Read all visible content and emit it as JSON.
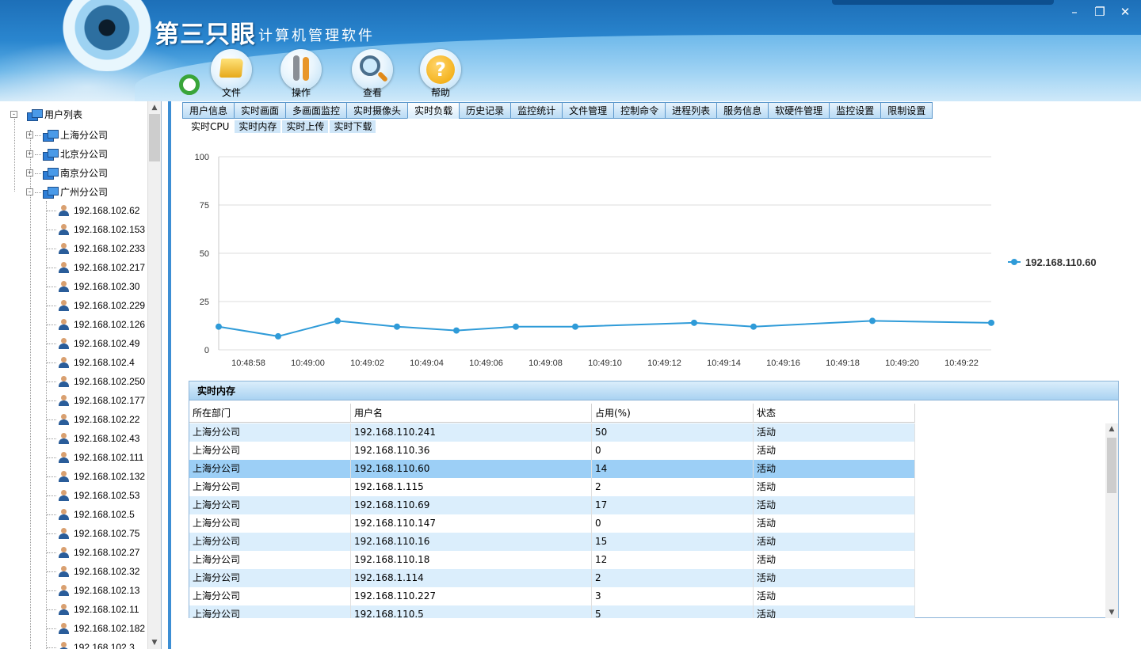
{
  "app": {
    "logo_text": "第三只眼",
    "subtitle": "计算机管理软件",
    "window_controls": {
      "minimize": "–",
      "restore": "❐",
      "close": "✕"
    }
  },
  "toolbar": {
    "items": [
      {
        "label": "文件",
        "icon": "folder-icon"
      },
      {
        "label": "操作",
        "icon": "tools-icon"
      },
      {
        "label": "查看",
        "icon": "magnifier-icon"
      },
      {
        "label": "帮助",
        "icon": "help-icon"
      }
    ],
    "help_glyph": "?"
  },
  "tree": {
    "root_label": "用户列表",
    "groups": [
      {
        "label": "上海分公司",
        "expander": "+"
      },
      {
        "label": "北京分公司",
        "expander": "+"
      },
      {
        "label": "南京分公司",
        "expander": "+"
      },
      {
        "label": "广州分公司",
        "expander": "-"
      }
    ],
    "root_expander": "-",
    "hosts": [
      "192.168.102.62",
      "192.168.102.153",
      "192.168.102.233",
      "192.168.102.217",
      "192.168.102.30",
      "192.168.102.229",
      "192.168.102.126",
      "192.168.102.49",
      "192.168.102.4",
      "192.168.102.250",
      "192.168.102.177",
      "192.168.102.22",
      "192.168.102.43",
      "192.168.102.111",
      "192.168.102.132",
      "192.168.102.53",
      "192.168.102.5",
      "192.168.102.75",
      "192.168.102.27",
      "192.168.102.32",
      "192.168.102.13",
      "192.168.102.11",
      "192.168.102.182",
      "192.168.102.3"
    ],
    "scroll_up": "▲",
    "scroll_down": "▼"
  },
  "tabs": {
    "items": [
      "用户信息",
      "实时画面",
      "多画面监控",
      "实时摄像头",
      "实时负载",
      "历史记录",
      "监控统计",
      "文件管理",
      "控制命令",
      "进程列表",
      "服务信息",
      "软硬件管理",
      "监控设置",
      "限制设置"
    ],
    "active": "实时负载"
  },
  "subtabs": {
    "items": [
      "实时CPU",
      "实时内存",
      "实时上传",
      "实时下载"
    ],
    "active": "实时CPU"
  },
  "chart_data": {
    "type": "line",
    "x": [
      "10:48:57",
      "10:48:59",
      "10:49:01",
      "10:49:03",
      "10:49:05",
      "10:49:07",
      "10:49:09",
      "10:49:13",
      "10:49:15",
      "10:49:19",
      "10:49:23"
    ],
    "x_tick_labels": [
      "10:48:58",
      "10:49:00",
      "10:49:02",
      "10:49:04",
      "10:49:06",
      "10:49:08",
      "10:49:10",
      "10:49:12",
      "10:49:14",
      "10:49:16",
      "10:49:18",
      "10:49:20",
      "10:49:22"
    ],
    "y_ticks": [
      0,
      25,
      50,
      75,
      100
    ],
    "ylim": [
      0,
      100
    ],
    "series": [
      {
        "name": "192.168.110.60",
        "values": [
          12,
          7,
          15,
          12,
          10,
          12,
          12,
          14,
          12,
          15,
          14
        ]
      }
    ],
    "grid": "horizontal",
    "legend_position": "right",
    "color": "#2f9bd8"
  },
  "memory_panel": {
    "title": "实时内存",
    "columns": [
      "所在部门",
      "用户名",
      "占用(%)",
      "状态"
    ],
    "rows": [
      [
        "上海分公司",
        "192.168.110.241",
        "50",
        "活动"
      ],
      [
        "上海分公司",
        "192.168.110.36",
        "0",
        "活动"
      ],
      [
        "上海分公司",
        "192.168.110.60",
        "14",
        "活动"
      ],
      [
        "上海分公司",
        "192.168.1.115",
        "2",
        "活动"
      ],
      [
        "上海分公司",
        "192.168.110.69",
        "17",
        "活动"
      ],
      [
        "上海分公司",
        "192.168.110.147",
        "0",
        "活动"
      ],
      [
        "上海分公司",
        "192.168.110.16",
        "15",
        "活动"
      ],
      [
        "上海分公司",
        "192.168.110.18",
        "12",
        "活动"
      ],
      [
        "上海分公司",
        "192.168.1.114",
        "2",
        "活动"
      ],
      [
        "上海分公司",
        "192.168.110.227",
        "3",
        "活动"
      ],
      [
        "上海分公司",
        "192.168.110.5",
        "5",
        "活动"
      ]
    ],
    "selected_row": 2,
    "scroll_up": "▲",
    "scroll_down": "▼"
  }
}
